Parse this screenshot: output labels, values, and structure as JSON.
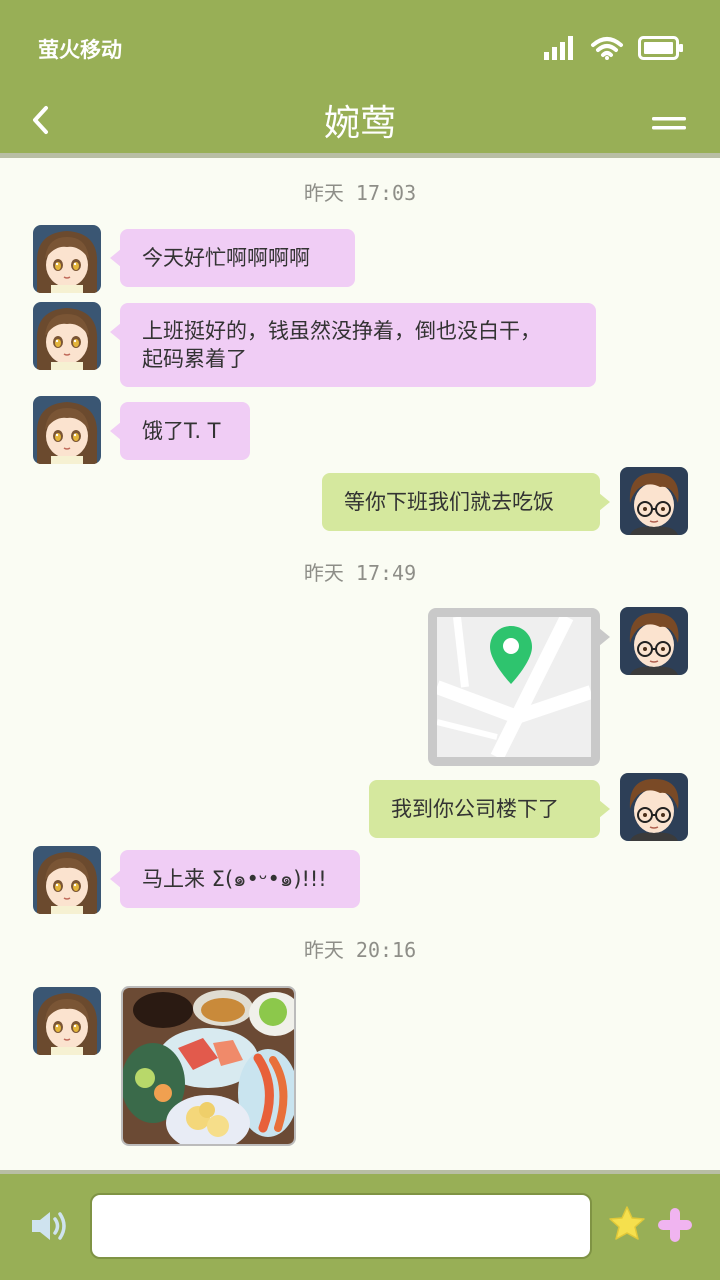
{
  "status_bar": {
    "carrier": "萤火移动",
    "icons": [
      "signal-icon",
      "wifi-icon",
      "battery-icon"
    ]
  },
  "header": {
    "title": "婉莺",
    "back_icon": "chevron-left-icon",
    "menu_icon": "menu-icon"
  },
  "timestamps": [
    "昨天 17:03",
    "昨天 17:49",
    "昨天 20:16"
  ],
  "messages": [
    {
      "side": "left",
      "type": "text",
      "text": "今天好忙啊啊啊啊"
    },
    {
      "side": "left",
      "type": "text",
      "lines": [
        "上班挺好的，钱虽然没挣着，倒也没白干，",
        "起码累着了"
      ]
    },
    {
      "side": "left",
      "type": "text",
      "text": "饿了T. T"
    },
    {
      "side": "right",
      "type": "text",
      "text": "等你下班我们就去吃饭"
    },
    {
      "side": "right",
      "type": "location",
      "icon": "map-pin-icon"
    },
    {
      "side": "right",
      "type": "text",
      "text": "我到你公司楼下了"
    },
    {
      "side": "left",
      "type": "text",
      "text": "马上来 Σ(๑•ᵕ•๑)!!!"
    },
    {
      "side": "left",
      "type": "image",
      "icon": "food-photo"
    }
  ],
  "input_bar": {
    "placeholder": "",
    "voice_icon": "speaker-icon",
    "emoji_icon": "star-icon",
    "more_icon": "plus-icon"
  },
  "colors": {
    "header_bg": "#98af56",
    "chat_bg": "#fafcf3",
    "bubble_left": "#f0cdf5",
    "bubble_right": "#d5e89e",
    "pin": "#2ec46e",
    "star": "#f5e04d",
    "plus": "#f0b4f0"
  }
}
